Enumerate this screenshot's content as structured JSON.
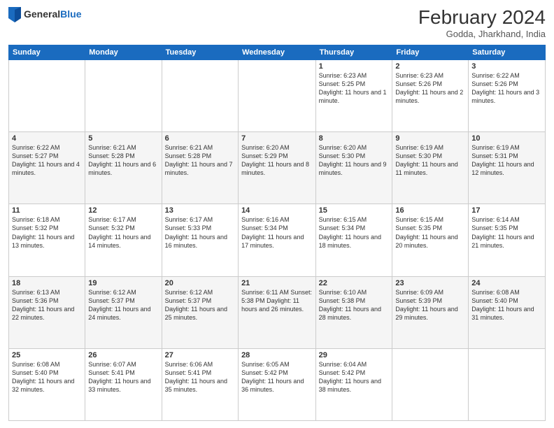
{
  "header": {
    "logo_general": "General",
    "logo_blue": "Blue",
    "month_year": "February 2024",
    "location": "Godda, Jharkhand, India"
  },
  "days_of_week": [
    "Sunday",
    "Monday",
    "Tuesday",
    "Wednesday",
    "Thursday",
    "Friday",
    "Saturday"
  ],
  "weeks": [
    [
      {
        "day": "",
        "info": ""
      },
      {
        "day": "",
        "info": ""
      },
      {
        "day": "",
        "info": ""
      },
      {
        "day": "",
        "info": ""
      },
      {
        "day": "1",
        "info": "Sunrise: 6:23 AM\nSunset: 5:25 PM\nDaylight: 11 hours and 1 minute."
      },
      {
        "day": "2",
        "info": "Sunrise: 6:23 AM\nSunset: 5:26 PM\nDaylight: 11 hours and 2 minutes."
      },
      {
        "day": "3",
        "info": "Sunrise: 6:22 AM\nSunset: 5:26 PM\nDaylight: 11 hours and 3 minutes."
      }
    ],
    [
      {
        "day": "4",
        "info": "Sunrise: 6:22 AM\nSunset: 5:27 PM\nDaylight: 11 hours and 4 minutes."
      },
      {
        "day": "5",
        "info": "Sunrise: 6:21 AM\nSunset: 5:28 PM\nDaylight: 11 hours and 6 minutes."
      },
      {
        "day": "6",
        "info": "Sunrise: 6:21 AM\nSunset: 5:28 PM\nDaylight: 11 hours and 7 minutes."
      },
      {
        "day": "7",
        "info": "Sunrise: 6:20 AM\nSunset: 5:29 PM\nDaylight: 11 hours and 8 minutes."
      },
      {
        "day": "8",
        "info": "Sunrise: 6:20 AM\nSunset: 5:30 PM\nDaylight: 11 hours and 9 minutes."
      },
      {
        "day": "9",
        "info": "Sunrise: 6:19 AM\nSunset: 5:30 PM\nDaylight: 11 hours and 11 minutes."
      },
      {
        "day": "10",
        "info": "Sunrise: 6:19 AM\nSunset: 5:31 PM\nDaylight: 11 hours and 12 minutes."
      }
    ],
    [
      {
        "day": "11",
        "info": "Sunrise: 6:18 AM\nSunset: 5:32 PM\nDaylight: 11 hours and 13 minutes."
      },
      {
        "day": "12",
        "info": "Sunrise: 6:17 AM\nSunset: 5:32 PM\nDaylight: 11 hours and 14 minutes."
      },
      {
        "day": "13",
        "info": "Sunrise: 6:17 AM\nSunset: 5:33 PM\nDaylight: 11 hours and 16 minutes."
      },
      {
        "day": "14",
        "info": "Sunrise: 6:16 AM\nSunset: 5:34 PM\nDaylight: 11 hours and 17 minutes."
      },
      {
        "day": "15",
        "info": "Sunrise: 6:15 AM\nSunset: 5:34 PM\nDaylight: 11 hours and 18 minutes."
      },
      {
        "day": "16",
        "info": "Sunrise: 6:15 AM\nSunset: 5:35 PM\nDaylight: 11 hours and 20 minutes."
      },
      {
        "day": "17",
        "info": "Sunrise: 6:14 AM\nSunset: 5:35 PM\nDaylight: 11 hours and 21 minutes."
      }
    ],
    [
      {
        "day": "18",
        "info": "Sunrise: 6:13 AM\nSunset: 5:36 PM\nDaylight: 11 hours and 22 minutes."
      },
      {
        "day": "19",
        "info": "Sunrise: 6:12 AM\nSunset: 5:37 PM\nDaylight: 11 hours and 24 minutes."
      },
      {
        "day": "20",
        "info": "Sunrise: 6:12 AM\nSunset: 5:37 PM\nDaylight: 11 hours and 25 minutes."
      },
      {
        "day": "21",
        "info": "Sunrise: 6:11 AM\nSunset: 5:38 PM\nDaylight: 11 hours and 26 minutes."
      },
      {
        "day": "22",
        "info": "Sunrise: 6:10 AM\nSunset: 5:38 PM\nDaylight: 11 hours and 28 minutes."
      },
      {
        "day": "23",
        "info": "Sunrise: 6:09 AM\nSunset: 5:39 PM\nDaylight: 11 hours and 29 minutes."
      },
      {
        "day": "24",
        "info": "Sunrise: 6:08 AM\nSunset: 5:40 PM\nDaylight: 11 hours and 31 minutes."
      }
    ],
    [
      {
        "day": "25",
        "info": "Sunrise: 6:08 AM\nSunset: 5:40 PM\nDaylight: 11 hours and 32 minutes."
      },
      {
        "day": "26",
        "info": "Sunrise: 6:07 AM\nSunset: 5:41 PM\nDaylight: 11 hours and 33 minutes."
      },
      {
        "day": "27",
        "info": "Sunrise: 6:06 AM\nSunset: 5:41 PM\nDaylight: 11 hours and 35 minutes."
      },
      {
        "day": "28",
        "info": "Sunrise: 6:05 AM\nSunset: 5:42 PM\nDaylight: 11 hours and 36 minutes."
      },
      {
        "day": "29",
        "info": "Sunrise: 6:04 AM\nSunset: 5:42 PM\nDaylight: 11 hours and 38 minutes."
      },
      {
        "day": "",
        "info": ""
      },
      {
        "day": "",
        "info": ""
      }
    ]
  ]
}
